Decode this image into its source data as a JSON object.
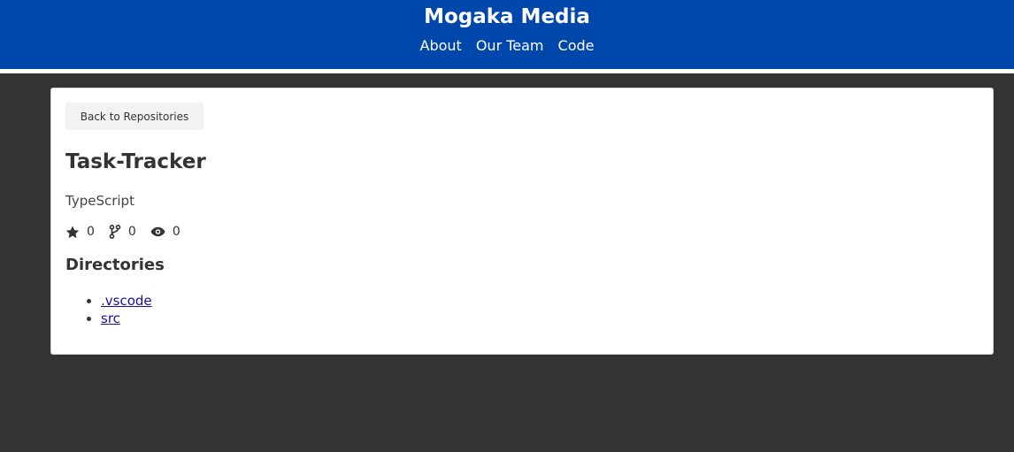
{
  "header": {
    "title": "Mogaka Media",
    "nav": [
      "About",
      "Our Team",
      "Code"
    ]
  },
  "repo": {
    "back_label": "Back to Repositories",
    "name": "Task-Tracker",
    "language": "TypeScript",
    "stars": "0",
    "forks": "0",
    "watchers": "0",
    "directories_heading": "Directories",
    "directories": [
      ".vscode",
      "src"
    ]
  },
  "colors": {
    "header_bg": "#0047ab",
    "page_bg": "#333333",
    "card_bg": "#ffffff",
    "link": "#1a0dab"
  },
  "icons": {
    "stars": "star-icon",
    "forks": "fork-icon",
    "watchers": "eye-icon"
  }
}
